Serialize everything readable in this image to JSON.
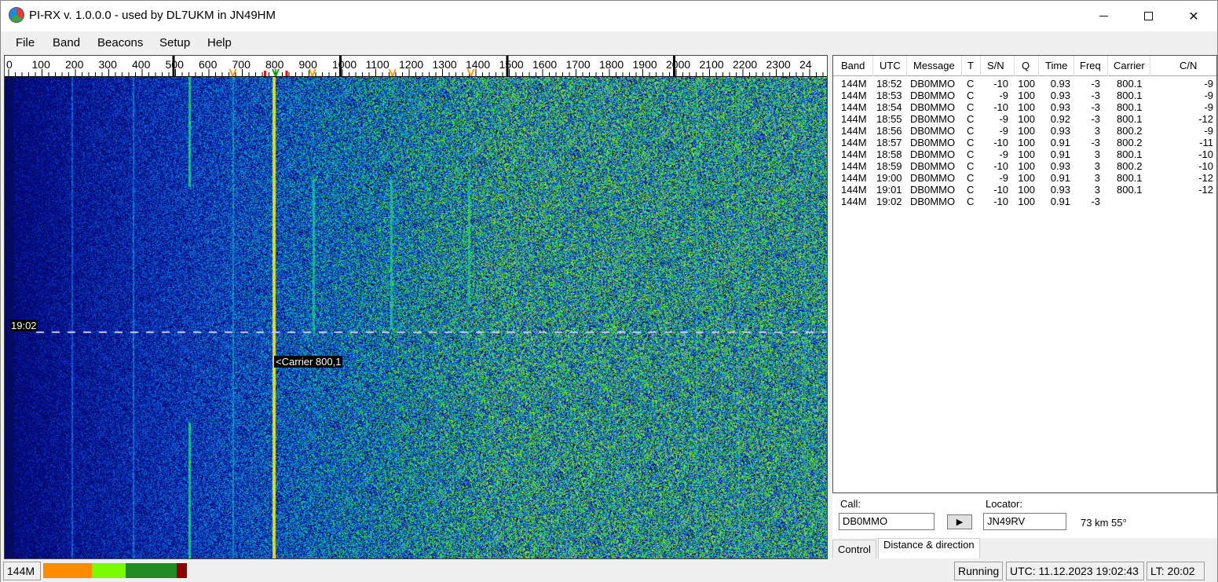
{
  "window": {
    "title": "PI-RX v. 1.0.0.0 - used by DL7UKM in JN49HM"
  },
  "menu": [
    "File",
    "Band",
    "Beacons",
    "Setup",
    "Help"
  ],
  "waterfall": {
    "ruler_labels": [
      "0",
      "100",
      "200",
      "300",
      "400",
      "500",
      "600",
      "700",
      "800",
      "900",
      "1000",
      "1100",
      "1200",
      "1300",
      "1400",
      "1500",
      "1600",
      "1700",
      "1800",
      "1900",
      "2000",
      "2100",
      "2200",
      "2300",
      "24"
    ],
    "time_marker": "19:02",
    "carrier_label": "<Carrier 800,1"
  },
  "table": {
    "columns": [
      "Band",
      "UTC",
      "Message",
      "T",
      "S/N",
      "Q",
      "Time",
      "Freq",
      "Carrier",
      "C/N"
    ],
    "rows": [
      [
        "144M",
        "18:52",
        "DB0MMO",
        "C",
        "-10",
        "100",
        "0.93",
        "-3",
        "800.1",
        "-9"
      ],
      [
        "144M",
        "18:53",
        "DB0MMO",
        "C",
        "-9",
        "100",
        "0.93",
        "-3",
        "800.1",
        "-9"
      ],
      [
        "144M",
        "18:54",
        "DB0MMO",
        "C",
        "-10",
        "100",
        "0.93",
        "-3",
        "800.1",
        "-9"
      ],
      [
        "144M",
        "18:55",
        "DB0MMO",
        "C",
        "-9",
        "100",
        "0.92",
        "-3",
        "800.1",
        "-12"
      ],
      [
        "144M",
        "18:56",
        "DB0MMO",
        "C",
        "-9",
        "100",
        "0.93",
        "3",
        "800.2",
        "-9"
      ],
      [
        "144M",
        "18:57",
        "DB0MMO",
        "C",
        "-10",
        "100",
        "0.91",
        "-3",
        "800.2",
        "-11"
      ],
      [
        "144M",
        "18:58",
        "DB0MMO",
        "C",
        "-9",
        "100",
        "0.91",
        "3",
        "800.1",
        "-10"
      ],
      [
        "144M",
        "18:59",
        "DB0MMO",
        "C",
        "-10",
        "100",
        "0.93",
        "3",
        "800.2",
        "-10"
      ],
      [
        "144M",
        "19:00",
        "DB0MMO",
        "C",
        "-9",
        "100",
        "0.91",
        "3",
        "800.1",
        "-12"
      ],
      [
        "144M",
        "19:01",
        "DB0MMO",
        "C",
        "-10",
        "100",
        "0.93",
        "3",
        "800.1",
        "-12"
      ],
      [
        "144M",
        "19:02",
        "DB0MMO",
        "C",
        "-10",
        "100",
        "0.91",
        "-3",
        "",
        ""
      ]
    ]
  },
  "distance": {
    "call_label": "Call:",
    "call_value": "DB0MMO",
    "locator_label": "Locator:",
    "locator_value": "JN49RV",
    "result": "73 km 55°"
  },
  "tabs": [
    "Control",
    "Distance & direction"
  ],
  "status": {
    "band": "144M",
    "state": "Running",
    "utc": "UTC:  11.12.2023  19:02:43",
    "lt": "LT:  20:02"
  },
  "colors": {
    "level_orange": "#ff8c00",
    "level_lime": "#7cfc00",
    "level_green": "#228b22",
    "level_darkred": "#8b0000"
  }
}
